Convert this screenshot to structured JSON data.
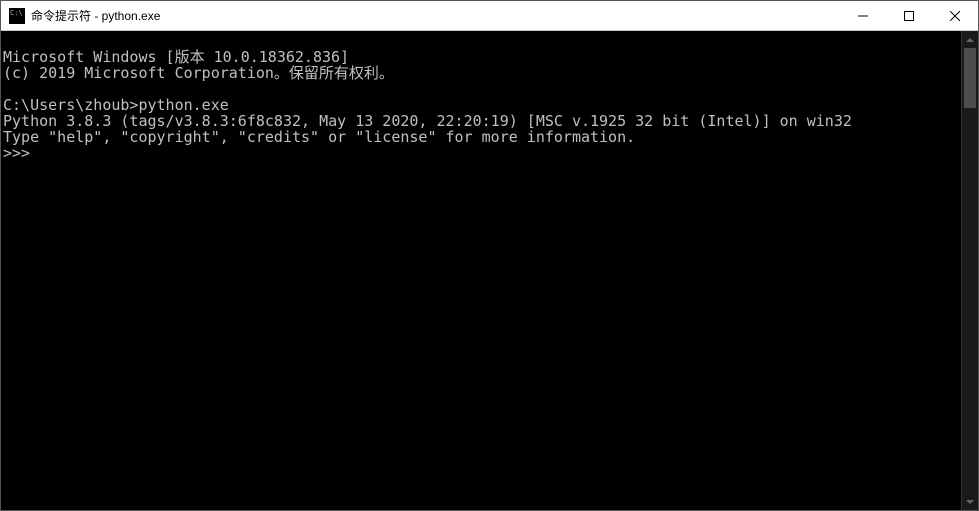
{
  "titlebar": {
    "title": "命令提示符 - python.exe"
  },
  "console": {
    "line1": "Microsoft Windows [版本 10.0.18362.836]",
    "line2": "(c) 2019 Microsoft Corporation。保留所有权利。",
    "line3": "",
    "line4": "C:\\Users\\zhoub>python.exe",
    "line5": "Python 3.8.3 (tags/v3.8.3:6f8c832, May 13 2020, 22:20:19) [MSC v.1925 32 bit (Intel)] on win32",
    "line6": "Type \"help\", \"copyright\", \"credits\" or \"license\" for more information.",
    "line7": ">>>"
  }
}
